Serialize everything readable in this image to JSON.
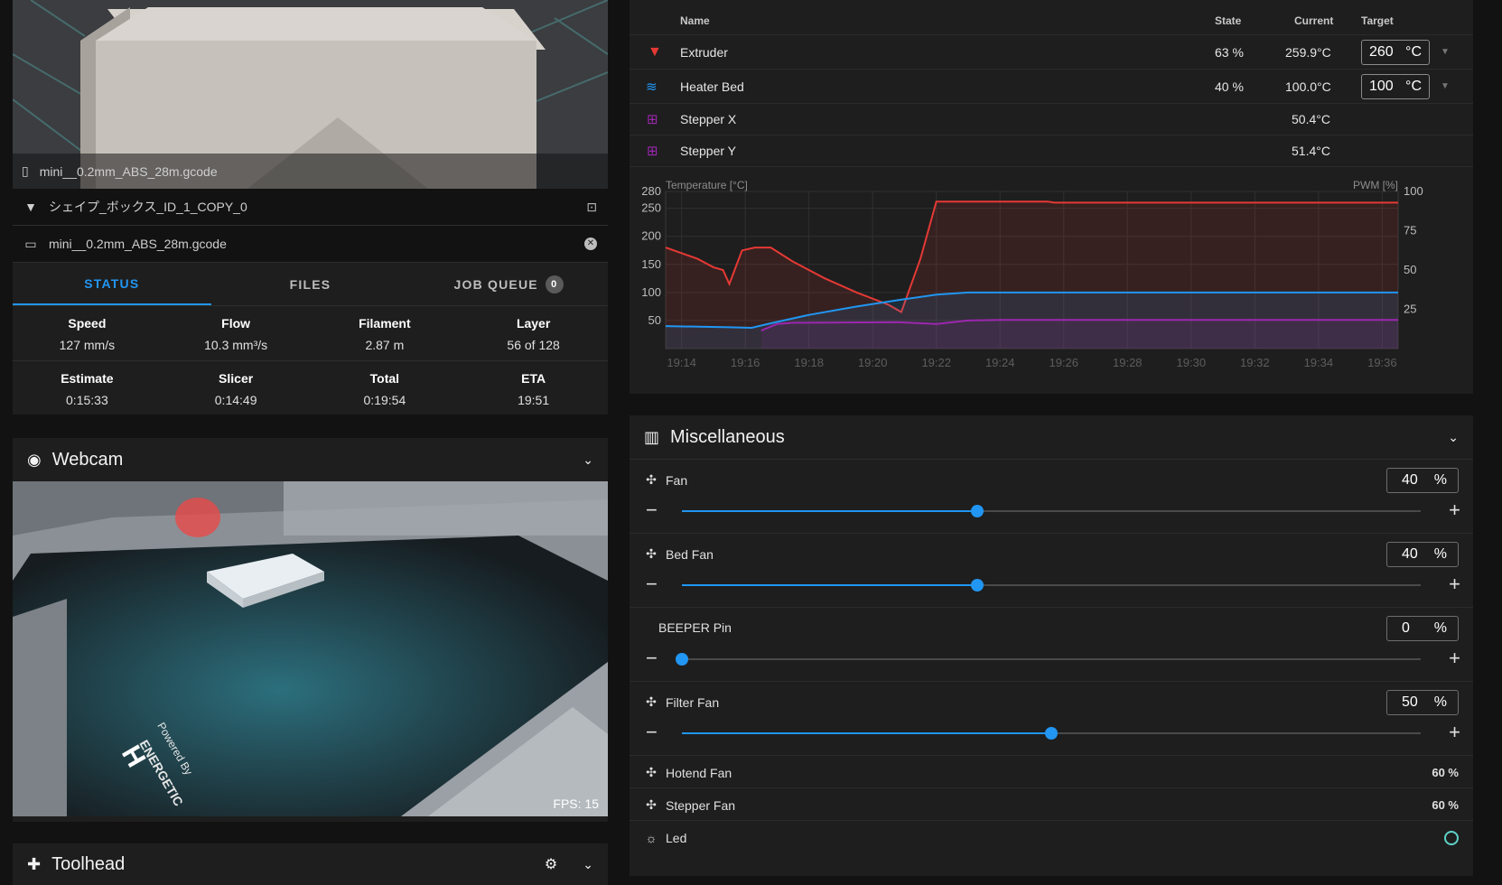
{
  "file": {
    "thumbnail_filename": "mini__0.2mm_ABS_28m.gcode",
    "object_name": "シェイプ_ボックス_ID_1_COPY_0",
    "gcode_filename": "mini__0.2mm_ABS_28m.gcode"
  },
  "tabs": [
    {
      "label": "STATUS"
    },
    {
      "label": "FILES"
    },
    {
      "label": "JOB QUEUE",
      "badge": "0"
    }
  ],
  "stats_row1": [
    {
      "label": "Speed",
      "value": "127 mm/s"
    },
    {
      "label": "Flow",
      "value": "10.3 mm³/s"
    },
    {
      "label": "Filament",
      "value": "2.87 m"
    },
    {
      "label": "Layer",
      "value": "56 of 128"
    }
  ],
  "stats_row2": [
    {
      "label": "Estimate",
      "value": "0:15:33"
    },
    {
      "label": "Slicer",
      "value": "0:14:49"
    },
    {
      "label": "Total",
      "value": "0:19:54"
    },
    {
      "label": "ETA",
      "value": "19:51"
    }
  ],
  "webcam": {
    "title": "Webcam",
    "fps": "FPS: 15"
  },
  "toolhead": {
    "title": "Toolhead"
  },
  "temps": {
    "headers": {
      "name": "Name",
      "state": "State",
      "current": "Current",
      "target": "Target"
    },
    "rows": [
      {
        "name": "Extruder",
        "state": "63 %",
        "current": "259.9°C",
        "target": "260",
        "unit": "°C",
        "icon": "extruder-icon",
        "color": "#e53935"
      },
      {
        "name": "Heater Bed",
        "state": "40 %",
        "current": "100.0°C",
        "target": "100",
        "unit": "°C",
        "icon": "heater-bed-icon",
        "color": "#2196f3"
      },
      {
        "name": "Stepper X",
        "state": "",
        "current": "50.4°C",
        "icon": "chip-icon",
        "color": "#9c27b0"
      },
      {
        "name": "Stepper Y",
        "state": "",
        "current": "51.4°C",
        "icon": "chip-icon",
        "color": "#9c27b0"
      }
    ]
  },
  "chart_data": {
    "type": "line",
    "ylabel": "Temperature [°C]",
    "y2label": "PWM [%]",
    "ylim": [
      0,
      280
    ],
    "y2lim": [
      0,
      100
    ],
    "yticks": [
      50,
      100,
      150,
      200,
      250,
      280
    ],
    "y2ticks": [
      25,
      50,
      75,
      100
    ],
    "xticks": [
      "19:14",
      "19:16",
      "19:18",
      "19:20",
      "19:22",
      "19:24",
      "19:26",
      "19:28",
      "19:30",
      "19:32",
      "19:34",
      "19:36"
    ],
    "x_minutes_range": [
      13.5,
      36.5
    ],
    "grid": true,
    "series": [
      {
        "name": "Extruder",
        "color": "#e53935",
        "points": [
          [
            13.5,
            180
          ],
          [
            14.5,
            160
          ],
          [
            15.0,
            145
          ],
          [
            15.3,
            140
          ],
          [
            15.5,
            115
          ],
          [
            15.9,
            175
          ],
          [
            16.3,
            180
          ],
          [
            16.8,
            180
          ],
          [
            17.5,
            155
          ],
          [
            18.5,
            125
          ],
          [
            19.5,
            100
          ],
          [
            20.5,
            78
          ],
          [
            20.9,
            65
          ],
          [
            21.5,
            160
          ],
          [
            22.0,
            262
          ],
          [
            25.5,
            262
          ],
          [
            25.7,
            260
          ],
          [
            36.5,
            260
          ]
        ]
      },
      {
        "name": "Heater Bed",
        "color": "#2196f3",
        "points": [
          [
            13.5,
            40
          ],
          [
            15.5,
            38
          ],
          [
            16.2,
            37
          ],
          [
            16.8,
            45
          ],
          [
            18.0,
            60
          ],
          [
            19.5,
            75
          ],
          [
            21.0,
            88
          ],
          [
            22.0,
            96
          ],
          [
            23.0,
            100
          ],
          [
            36.5,
            100
          ]
        ]
      },
      {
        "name": "Stepper X",
        "color": "#9c27b0",
        "points": [
          [
            13.5,
            null
          ],
          [
            16.5,
            32
          ],
          [
            17.0,
            44
          ],
          [
            17.5,
            46
          ],
          [
            20.8,
            47
          ],
          [
            21.0,
            null
          ],
          [
            22.0,
            44
          ],
          [
            23.0,
            50
          ],
          [
            24.0,
            51
          ],
          [
            36.5,
            51
          ]
        ]
      }
    ]
  },
  "misc": {
    "title": "Miscellaneous",
    "sliders": [
      {
        "name": "Fan",
        "value": "40",
        "unit": "%",
        "fraction": 0.4,
        "icon": "fan-icon"
      },
      {
        "name": "Bed Fan",
        "value": "40",
        "unit": "%",
        "fraction": 0.4,
        "icon": "fan-icon"
      },
      {
        "name": "BEEPER Pin",
        "value": "0",
        "unit": "%",
        "fraction": 0.0,
        "icon": ""
      },
      {
        "name": "Filter Fan",
        "value": "50",
        "unit": "%",
        "fraction": 0.5,
        "icon": "fan-icon"
      }
    ],
    "readonly": [
      {
        "name": "Hotend Fan",
        "value": "60 %"
      },
      {
        "name": "Stepper Fan",
        "value": "60 %"
      }
    ],
    "led": {
      "name": "Led"
    }
  },
  "colors": {
    "accent": "#2196f3",
    "panel": "#1e1e1e",
    "background": "#121212"
  }
}
